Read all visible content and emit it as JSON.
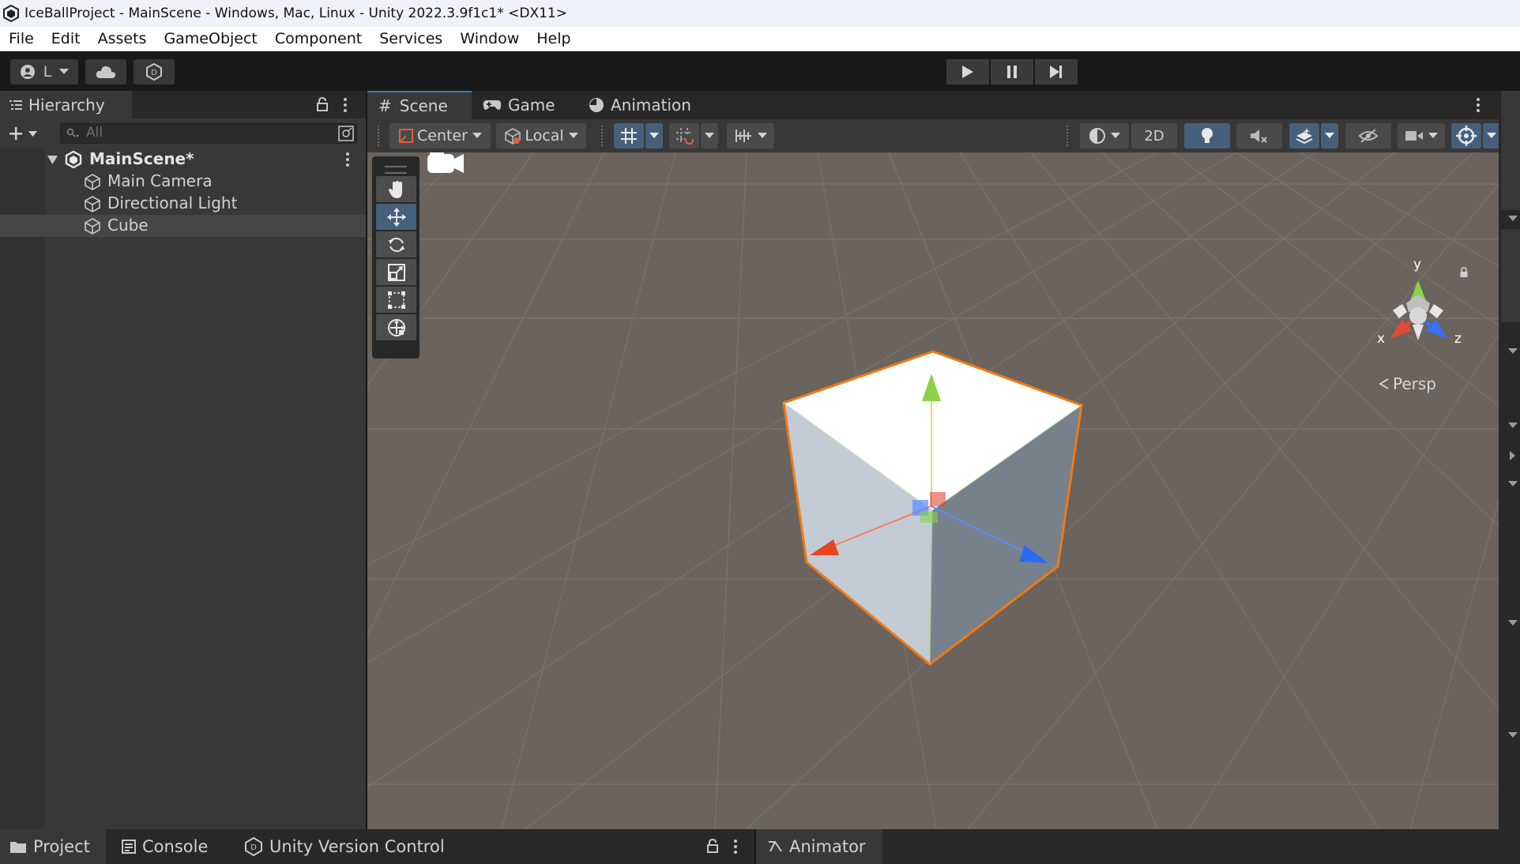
{
  "window": {
    "title": "IceBallProject - MainScene - Windows, Mac, Linux - Unity 2022.3.9f1c1* <DX11>"
  },
  "menu": [
    "File",
    "Edit",
    "Assets",
    "GameObject",
    "Component",
    "Services",
    "Window",
    "Help"
  ],
  "toolbar": {
    "account_label": "L"
  },
  "hierarchy": {
    "tab_label": "Hierarchy",
    "search_placeholder": "All",
    "scene_name": "MainScene*",
    "items": [
      "Main Camera",
      "Directional Light",
      "Cube"
    ],
    "selected": "Cube"
  },
  "scene_tabs": [
    "Scene",
    "Game",
    "Animation"
  ],
  "scene_toolbar": {
    "pivot_label": "Center",
    "space_label": "Local",
    "mode_2d_label": "2D"
  },
  "gizmo": {
    "y_label": "y",
    "x_label": "x",
    "z_label": "z",
    "projection_label": "Persp"
  },
  "bottom_tabs": {
    "project": "Project",
    "console": "Console",
    "version_control": "Unity Version Control",
    "animator": "Animator"
  },
  "colors": {
    "accent": "#46607c",
    "selection_outline": "#f07a14",
    "viewport_bg": "#6a635e"
  }
}
